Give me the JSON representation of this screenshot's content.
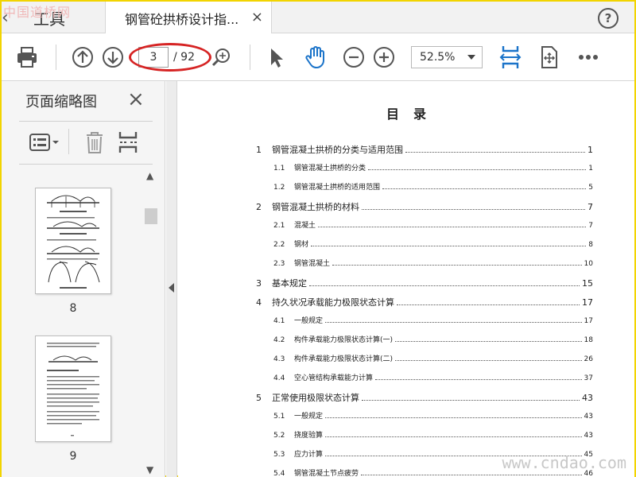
{
  "watermarks": {
    "top_left": "中国道桥网",
    "bottom_right": "www.cndao.com"
  },
  "tabs": {
    "prev_label": "工具",
    "active_label": "钢管砼拱桥设计指...",
    "close_glyph": "×",
    "help_glyph": "?"
  },
  "toolbar": {
    "current_page": "3",
    "total_pages": "/ 92",
    "zoom": "52.5%"
  },
  "left_pane": {
    "title": "页面缩略图",
    "close_glyph": "×",
    "thumbnails": [
      {
        "label": "8"
      },
      {
        "label": "9"
      }
    ]
  },
  "document": {
    "title": "目录",
    "toc": [
      {
        "num": "1",
        "text": "钢管混凝土拱桥的分类与适用范围",
        "page": "1",
        "level": 1
      },
      {
        "num": "1.1",
        "text": "钢管混凝土拱桥的分类",
        "page": "1",
        "level": 2
      },
      {
        "num": "1.2",
        "text": "钢管混凝土拱桥的适用范围",
        "page": "5",
        "level": 2
      },
      {
        "num": "2",
        "text": "钢管混凝土拱桥的材料",
        "page": "7",
        "level": 1
      },
      {
        "num": "2.1",
        "text": "混凝土",
        "page": "7",
        "level": 2
      },
      {
        "num": "2.2",
        "text": "钢材",
        "page": "8",
        "level": 2
      },
      {
        "num": "2.3",
        "text": "钢管混凝土",
        "page": "10",
        "level": 2
      },
      {
        "num": "3",
        "text": "基本规定",
        "page": "15",
        "level": 1
      },
      {
        "num": "4",
        "text": "持久状况承载能力极限状态计算",
        "page": "17",
        "level": 1
      },
      {
        "num": "4.1",
        "text": "一般规定",
        "page": "17",
        "level": 2
      },
      {
        "num": "4.2",
        "text": "构件承载能力极限状态计算(一)",
        "page": "18",
        "level": 2
      },
      {
        "num": "4.3",
        "text": "构件承载能力极限状态计算(二)",
        "page": "26",
        "level": 2
      },
      {
        "num": "4.4",
        "text": "空心管结构承载能力计算",
        "page": "37",
        "level": 2
      },
      {
        "num": "5",
        "text": "正常使用极限状态计算",
        "page": "43",
        "level": 1
      },
      {
        "num": "5.1",
        "text": "一般规定",
        "page": "43",
        "level": 2
      },
      {
        "num": "5.2",
        "text": "挠度验算",
        "page": "43",
        "level": 2
      },
      {
        "num": "5.3",
        "text": "应力计算",
        "page": "45",
        "level": 2
      },
      {
        "num": "5.4",
        "text": "钢管混凝土节点疲劳",
        "page": "46",
        "level": 2
      }
    ]
  },
  "colors": {
    "accent_blue": "#1a73c9",
    "annotation_red": "#d62424",
    "frame_yellow": "#f2d400"
  }
}
